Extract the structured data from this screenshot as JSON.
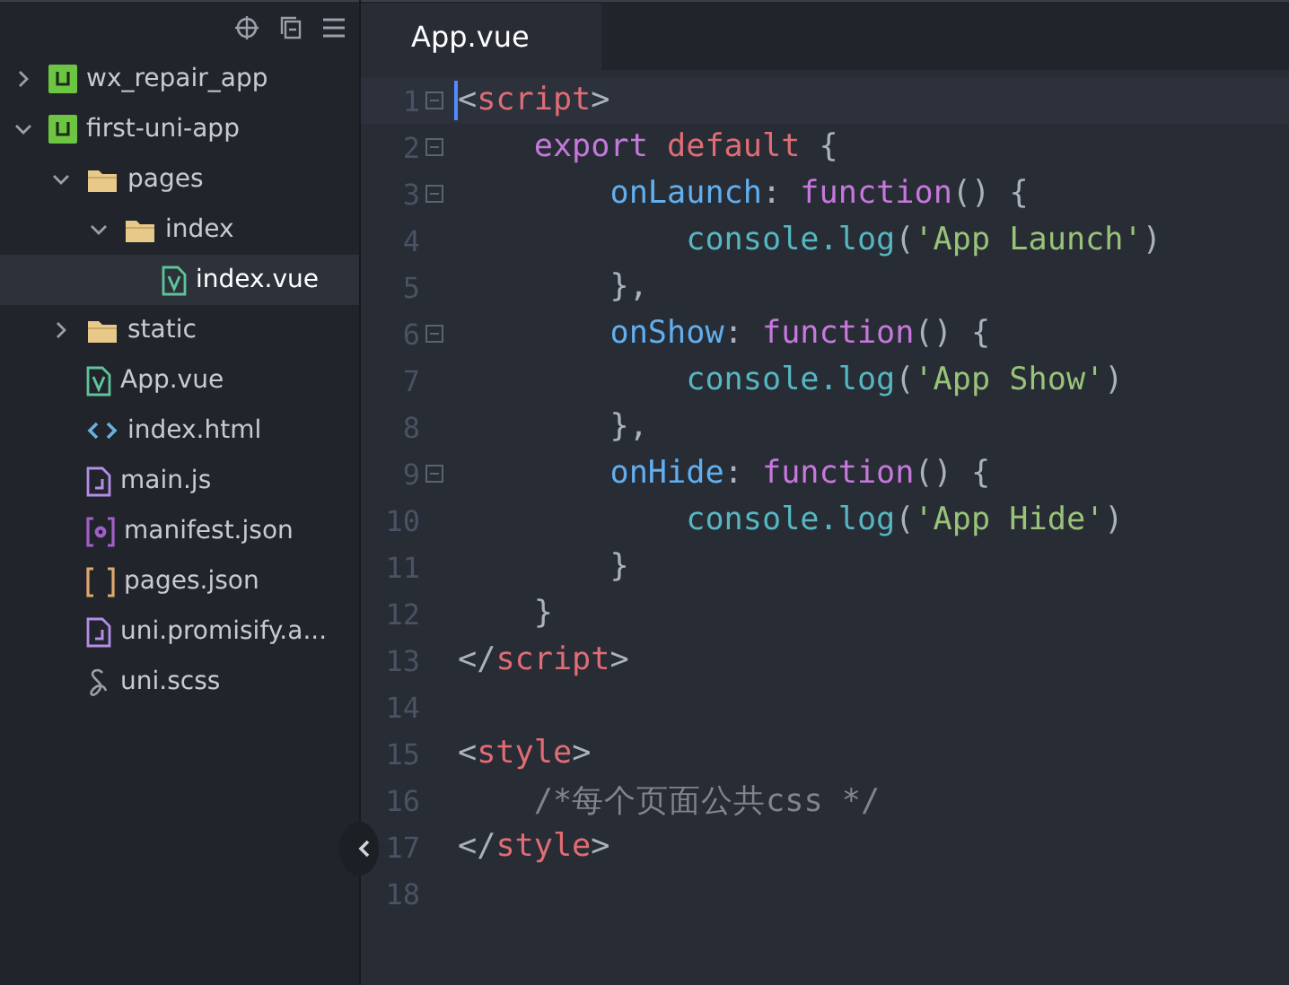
{
  "sidebar": {
    "items": [
      {
        "label": "wx_repair_app",
        "kind": "project",
        "expanded": false,
        "selected": false
      },
      {
        "label": "first-uni-app",
        "kind": "project",
        "expanded": true,
        "selected": false,
        "children": [
          {
            "label": "pages",
            "kind": "folder",
            "expanded": true,
            "selected": false,
            "children": [
              {
                "label": "index",
                "kind": "folder",
                "expanded": true,
                "selected": false,
                "children": [
                  {
                    "label": "index.vue",
                    "kind": "vue",
                    "selected": true
                  }
                ]
              }
            ]
          },
          {
            "label": "static",
            "kind": "folder",
            "expanded": false,
            "selected": false
          },
          {
            "label": "App.vue",
            "kind": "vue",
            "selected": false
          },
          {
            "label": "index.html",
            "kind": "html",
            "selected": false
          },
          {
            "label": "main.js",
            "kind": "js",
            "selected": false
          },
          {
            "label": "manifest.json",
            "kind": "manifest",
            "selected": false
          },
          {
            "label": "pages.json",
            "kind": "brackets",
            "selected": false
          },
          {
            "label": "uni.promisify.a...",
            "kind": "js",
            "selected": false
          },
          {
            "label": "uni.scss",
            "kind": "scss",
            "selected": false
          }
        ]
      }
    ]
  },
  "tabs": [
    {
      "label": "App.vue",
      "selected": true
    }
  ],
  "editor": {
    "lines": [
      {
        "number": "1",
        "foldable": true,
        "current": true,
        "tokens": [
          {
            "text": "<",
            "kind": "punct"
          },
          {
            "text": "script",
            "kind": "tag"
          },
          {
            "text": ">",
            "kind": "punct"
          }
        ]
      },
      {
        "number": "2",
        "foldable": true,
        "current": false,
        "tokens": [
          {
            "text": "    export",
            "kind": "keyword"
          },
          {
            "text": " default",
            "kind": "tag"
          },
          {
            "text": " {",
            "kind": "punct"
          }
        ]
      },
      {
        "number": "3",
        "foldable": true,
        "current": false,
        "tokens": [
          {
            "text": "        onLaunch",
            "kind": "prop"
          },
          {
            "text": ": ",
            "kind": "punct"
          },
          {
            "text": "function",
            "kind": "keyword"
          },
          {
            "text": "() {",
            "kind": "punct"
          }
        ]
      },
      {
        "number": "4",
        "foldable": false,
        "current": false,
        "tokens": [
          {
            "text": "            console.log",
            "kind": "fn"
          },
          {
            "text": "(",
            "kind": "punct"
          },
          {
            "text": "'App Launch'",
            "kind": "string"
          },
          {
            "text": ")",
            "kind": "punct"
          }
        ]
      },
      {
        "number": "5",
        "foldable": false,
        "current": false,
        "tokens": [
          {
            "text": "        },",
            "kind": "punct"
          }
        ]
      },
      {
        "number": "6",
        "foldable": true,
        "current": false,
        "tokens": [
          {
            "text": "        onShow",
            "kind": "prop"
          },
          {
            "text": ": ",
            "kind": "punct"
          },
          {
            "text": "function",
            "kind": "keyword"
          },
          {
            "text": "() {",
            "kind": "punct"
          }
        ]
      },
      {
        "number": "7",
        "foldable": false,
        "current": false,
        "tokens": [
          {
            "text": "            console.log",
            "kind": "fn"
          },
          {
            "text": "(",
            "kind": "punct"
          },
          {
            "text": "'App Show'",
            "kind": "string"
          },
          {
            "text": ")",
            "kind": "punct"
          }
        ]
      },
      {
        "number": "8",
        "foldable": false,
        "current": false,
        "tokens": [
          {
            "text": "        },",
            "kind": "punct"
          }
        ]
      },
      {
        "number": "9",
        "foldable": true,
        "current": false,
        "tokens": [
          {
            "text": "        onHide",
            "kind": "prop"
          },
          {
            "text": ": ",
            "kind": "punct"
          },
          {
            "text": "function",
            "kind": "keyword"
          },
          {
            "text": "() {",
            "kind": "punct"
          }
        ]
      },
      {
        "number": "10",
        "foldable": false,
        "current": false,
        "tokens": [
          {
            "text": "            console.log",
            "kind": "fn"
          },
          {
            "text": "(",
            "kind": "punct"
          },
          {
            "text": "'App Hide'",
            "kind": "string"
          },
          {
            "text": ")",
            "kind": "punct"
          }
        ]
      },
      {
        "number": "11",
        "foldable": false,
        "current": false,
        "tokens": [
          {
            "text": "        }",
            "kind": "punct"
          }
        ]
      },
      {
        "number": "12",
        "foldable": false,
        "current": false,
        "tokens": [
          {
            "text": "    }",
            "kind": "punct"
          }
        ]
      },
      {
        "number": "13",
        "foldable": false,
        "current": false,
        "tokens": [
          {
            "text": "</",
            "kind": "punct"
          },
          {
            "text": "script",
            "kind": "tag"
          },
          {
            "text": ">",
            "kind": "punct"
          }
        ]
      },
      {
        "number": "14",
        "foldable": false,
        "current": false
      },
      {
        "number": "15",
        "foldable": false,
        "current": false,
        "tokens": [
          {
            "text": "<",
            "kind": "punct"
          },
          {
            "text": "style",
            "kind": "tag"
          },
          {
            "text": ">",
            "kind": "punct"
          }
        ]
      },
      {
        "number": "16",
        "foldable": false,
        "current": false,
        "tokens": [
          {
            "text": "    /*每个页面公共css */",
            "kind": "comment"
          }
        ]
      },
      {
        "number": "17",
        "foldable": false,
        "current": false,
        "tokens": [
          {
            "text": "</",
            "kind": "punct"
          },
          {
            "text": "style",
            "kind": "tag"
          },
          {
            "text": ">",
            "kind": "punct"
          }
        ]
      },
      {
        "number": "18",
        "foldable": false,
        "current": false
      }
    ]
  }
}
